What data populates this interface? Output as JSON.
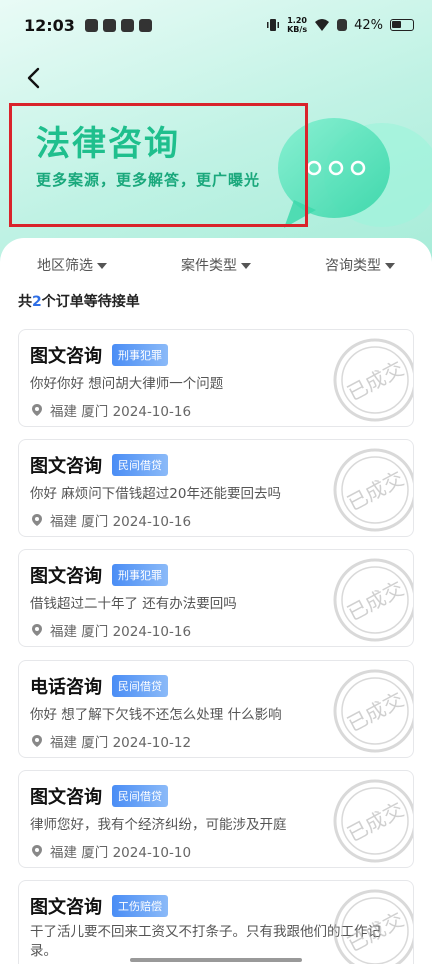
{
  "status": {
    "time": "12:03",
    "net_speed_value": "1.20",
    "net_speed_unit": "KB/s",
    "battery": "42%"
  },
  "banner": {
    "title": "法律咨询",
    "subtitle": "更多案源，更多解答，更广曝光"
  },
  "filters": [
    {
      "label": "地区筛选"
    },
    {
      "label": "案件类型"
    },
    {
      "label": "咨询类型"
    }
  ],
  "summary": {
    "prefix": "共",
    "count": "2",
    "suffix": "个订单等待接单"
  },
  "stamp_text": "已成交",
  "orders": [
    {
      "title": "图文咨询",
      "tag": "刑事犯罪",
      "desc": "你好你好 想问胡大律师一个问题",
      "location": "福建 厦门 2024-10-16"
    },
    {
      "title": "图文咨询",
      "tag": "民间借贷",
      "desc": "你好 麻烦问下借钱超过20年还能要回去吗",
      "location": "福建 厦门 2024-10-16"
    },
    {
      "title": "图文咨询",
      "tag": "刑事犯罪",
      "desc": "借钱超过二十年了 还有办法要回吗",
      "location": "福建 厦门 2024-10-16"
    },
    {
      "title": "电话咨询",
      "tag": "民间借贷",
      "desc": "你好 想了解下欠钱不还怎么处理 什么影响",
      "location": "福建 厦门 2024-10-12"
    },
    {
      "title": "图文咨询",
      "tag": "民间借贷",
      "desc": "律师您好，我有个经济纠纷，可能涉及开庭",
      "location": "福建 厦门 2024-10-10"
    },
    {
      "title": "图文咨询",
      "tag": "工伤赔偿",
      "desc": "干了活儿要不回来工资又不打条子。只有我跟他们的工作记录。",
      "location": ""
    }
  ]
}
